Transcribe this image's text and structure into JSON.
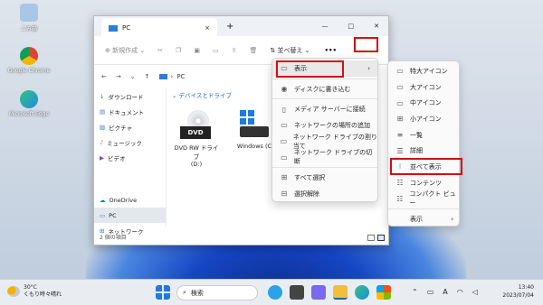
{
  "desktop": {
    "icons": [
      {
        "label": "ごみ箱",
        "icon": "recycle-bin-icon",
        "color": "#6aa0d8"
      },
      {
        "label": "Google Chrome",
        "icon": "chrome-icon",
        "color": "#e6b31e"
      },
      {
        "label": "Microsoft Edge",
        "icon": "edge-icon",
        "color": "#1f8ae0"
      }
    ]
  },
  "window": {
    "tab_title": "PC",
    "tab_close": "×",
    "new_tab": "+",
    "controls": {
      "min": "—",
      "max": "□",
      "close": "✕"
    },
    "toolbar": {
      "new_label": "新規作成",
      "sort_label": "並べ替え",
      "more_label": "•••"
    },
    "address": {
      "path": "PC"
    },
    "sidebar": [
      "ダウンロード",
      "ドキュメント",
      "ピクチャ",
      "ミュージック",
      "ビデオ",
      "OneDrive",
      "PC",
      "ネットワーク"
    ],
    "section_title": "デバイスとドライブ",
    "drives": [
      {
        "badge": "DVD",
        "name": "DVD RW ドライブ",
        "letter": "(D:)"
      },
      {
        "name": "Windows (C"
      }
    ],
    "status": "2 個の項目"
  },
  "context_menu": {
    "items": [
      "表示",
      "ディスクに書き込む",
      "メディア サーバーに接続",
      "ネットワークの場所の追加",
      "ネットワーク ドライブの割り当て",
      "ネットワーク ドライブの切断",
      "すべて選択",
      "選択解除"
    ]
  },
  "view_submenu": {
    "items": [
      "特大アイコン",
      "大アイコン",
      "中アイコン",
      "小アイコン",
      "一覧",
      "詳細",
      "並べて表示",
      "コンテンツ",
      "コンパクト ビュー",
      "表示"
    ],
    "highlighted": "並べて表示"
  },
  "taskbar": {
    "weather_temp": "30°C",
    "weather_desc": "くもり時々晴れ",
    "search_label": "検索",
    "ime": "A",
    "time": "13:40",
    "date": "2023/07/04"
  },
  "colors": {
    "highlight_box": "#d01010",
    "accent": "#0067c0"
  }
}
